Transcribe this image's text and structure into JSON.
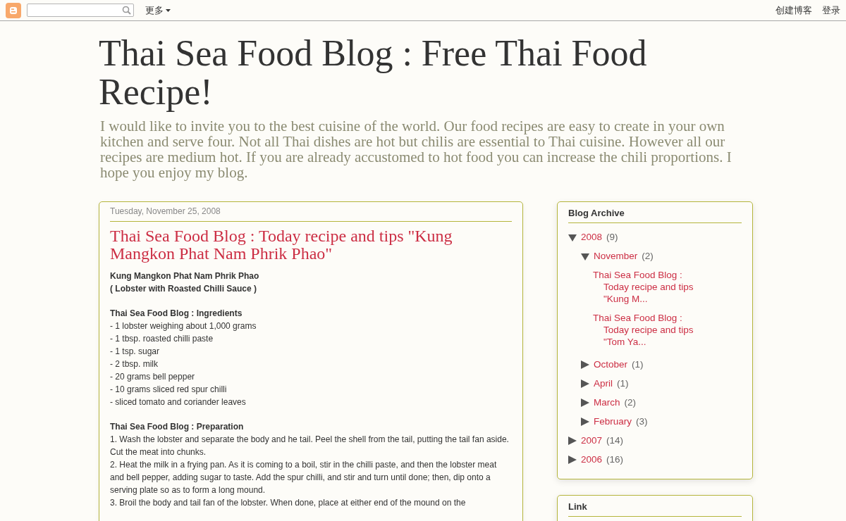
{
  "navbar": {
    "more": "更多",
    "links": [
      "创建博客",
      "登录"
    ]
  },
  "header": {
    "title": "Thai Sea Food Blog : Free Thai Food Recipe!",
    "description": "I would like to invite you to the best cuisine of the world. Our food recipes are easy to create in your own kitchen and serve four. Not all Thai dishes are hot but chilis are essential to Thai cuisine. However all our recipes are medium hot. If you are already accustomed to hot food you can increase the chili proportions. I hope you enjoy my blog."
  },
  "post": {
    "date": "Tuesday, November 25, 2008",
    "title": "Thai Sea Food Blog : Today recipe and tips \"Kung Mangkon Phat Nam Phrik Phao\"",
    "sections": [
      {
        "headings": [
          "Kung Mangkon Phat Nam Phrik Phao",
          "( Lobster with Roasted Chilli Sauce )"
        ]
      },
      {
        "headings": [
          "Thai Sea Food Blog : Ingredients"
        ],
        "lines": [
          "- 1 lobster weighing about 1,000 grams",
          "- 1 tbsp. roasted chilli paste",
          "- 1 tsp. sugar",
          "- 2 tbsp. milk",
          "- 20 grams bell pepper",
          "- 10 grams sliced red spur chilli",
          "- sliced tomato and coriander leaves"
        ]
      },
      {
        "headings": [
          "Thai Sea Food Blog : Preparation"
        ],
        "lines": [
          "1. Wash the lobster and separate the body and he tail. Peel the shell from the tail, putting the tail fan aside. Cut the meat into chunks.",
          "2. Heat the milk in a frying pan. As it is coming to a boil, stir in the chilli paste, and then the lobster meat and bell pepper, adding sugar to taste. Add the spur chilli, and stir and turn until done; then, dip onto a serving plate so as to form a long mound.",
          "3. Broil the body and tail fan of the lobster. When done, place at either end of the mound on the"
        ]
      }
    ]
  },
  "sidebar": {
    "archive": {
      "title": "Blog Archive",
      "items": [
        {
          "label": "2008",
          "count": "(9)",
          "expanded": true,
          "children": [
            {
              "label": "November",
              "count": "(2)",
              "expanded": true,
              "posts": [
                "Thai Sea Food Blog : Today recipe and tips \"Kung M...",
                "Thai Sea Food Blog : Today recipe and tips \"Tom Ya..."
              ]
            },
            {
              "label": "October",
              "count": "(1)",
              "expanded": false
            },
            {
              "label": "April",
              "count": "(1)",
              "expanded": false
            },
            {
              "label": "March",
              "count": "(2)",
              "expanded": false
            },
            {
              "label": "February",
              "count": "(3)",
              "expanded": false
            }
          ]
        },
        {
          "label": "2007",
          "count": "(14)",
          "expanded": false
        },
        {
          "label": "2006",
          "count": "(16)",
          "expanded": false
        }
      ]
    },
    "link": {
      "title": "Link"
    }
  }
}
